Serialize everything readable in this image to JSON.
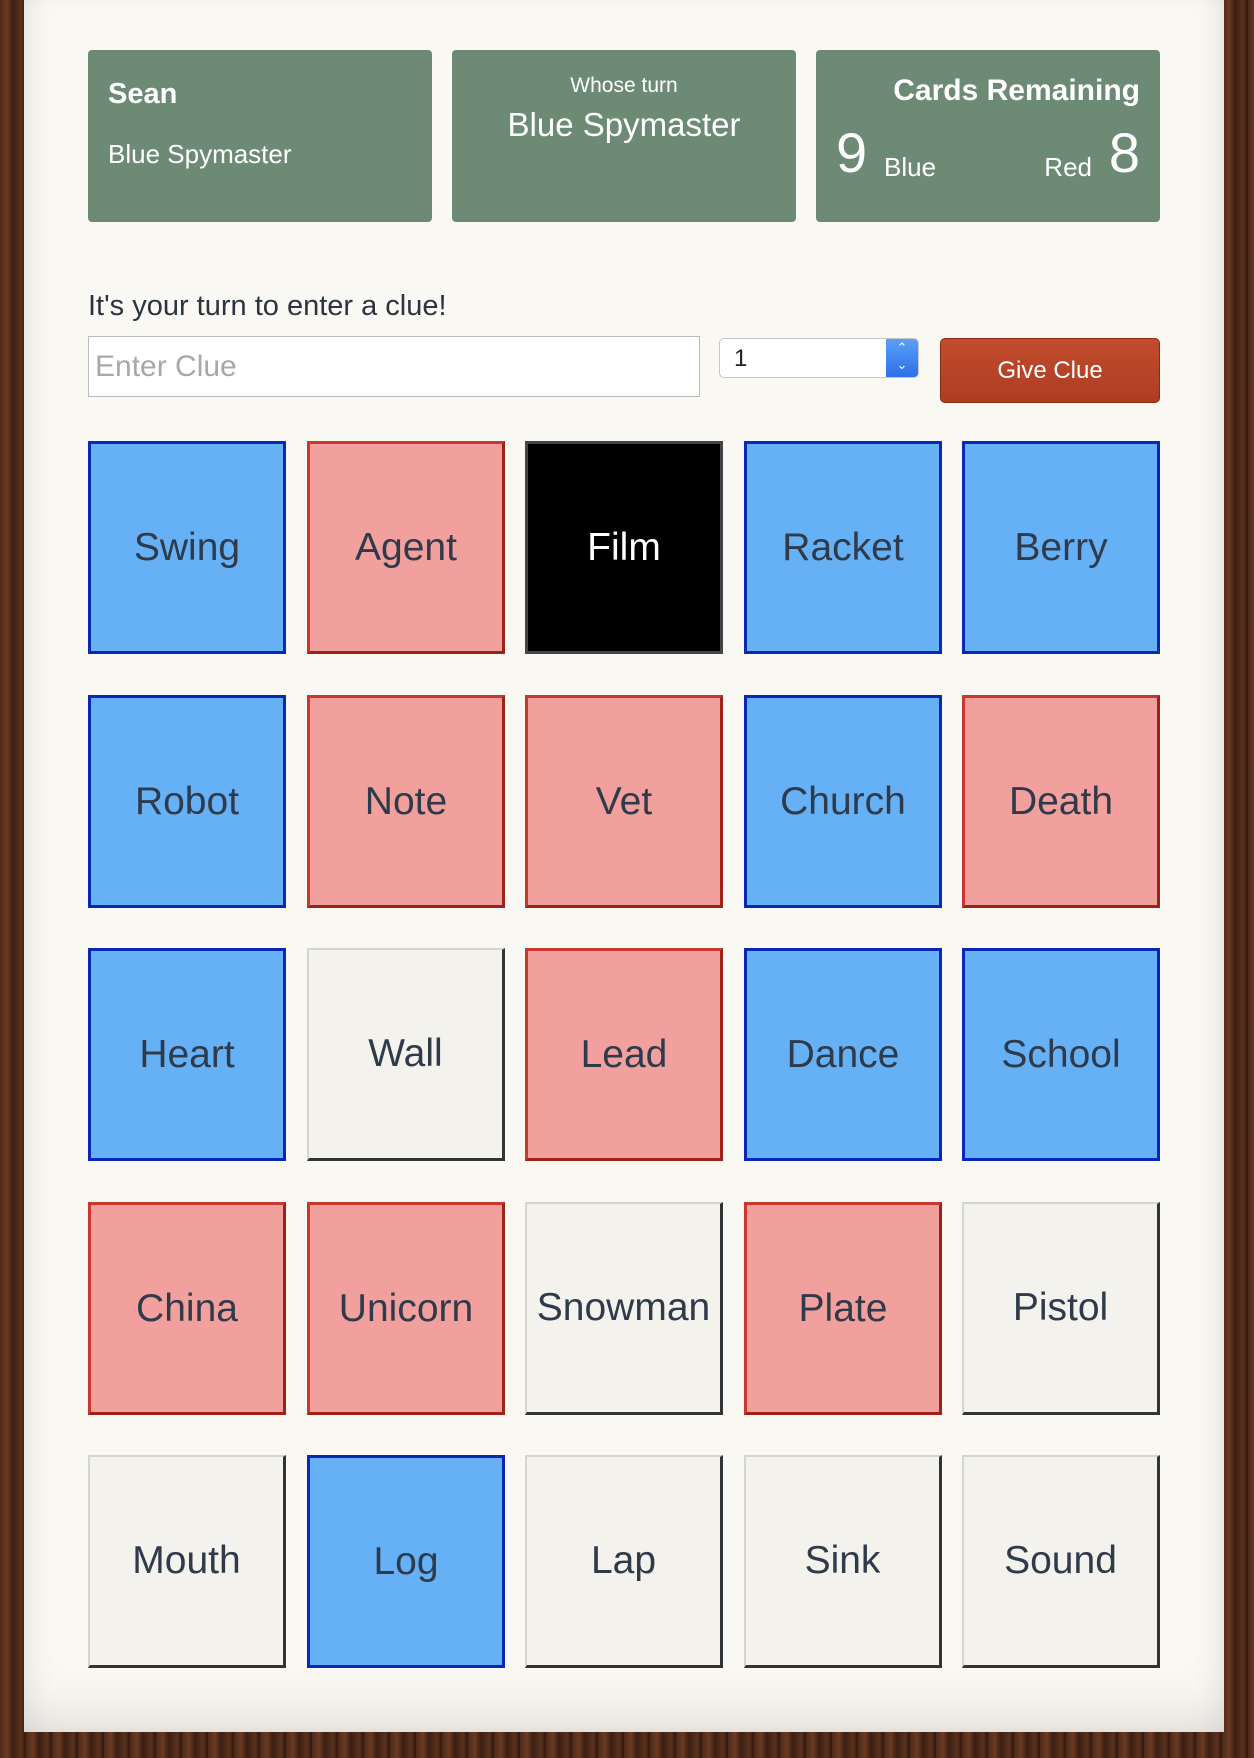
{
  "player": {
    "name": "Sean",
    "role": "Blue Spymaster"
  },
  "turn": {
    "label": "Whose turn",
    "value": "Blue Spymaster"
  },
  "cards_remaining": {
    "title": "Cards Remaining",
    "blue_count": "9",
    "blue_label": "Blue",
    "red_label": "Red",
    "red_count": "8"
  },
  "clue": {
    "prompt": "It's your turn to enter a clue!",
    "placeholder": "Enter Clue",
    "value": "",
    "count": "1",
    "button_label": "Give Clue"
  },
  "colors": {
    "blue": "#66b1f6",
    "red": "#f2a09d",
    "neutral": "#f3f2ec",
    "assassin": "#000000",
    "info_panel": "#6d8b74",
    "button": "#b8442a"
  },
  "board": [
    {
      "word": "Swing",
      "team": "blue"
    },
    {
      "word": "Agent",
      "team": "red"
    },
    {
      "word": "Film",
      "team": "black"
    },
    {
      "word": "Racket",
      "team": "blue"
    },
    {
      "word": "Berry",
      "team": "blue"
    },
    {
      "word": "Robot",
      "team": "blue"
    },
    {
      "word": "Note",
      "team": "red"
    },
    {
      "word": "Vet",
      "team": "red"
    },
    {
      "word": "Church",
      "team": "blue"
    },
    {
      "word": "Death",
      "team": "red"
    },
    {
      "word": "Heart",
      "team": "blue"
    },
    {
      "word": "Wall",
      "team": "neutral"
    },
    {
      "word": "Lead",
      "team": "red"
    },
    {
      "word": "Dance",
      "team": "blue"
    },
    {
      "word": "School",
      "team": "blue"
    },
    {
      "word": "China",
      "team": "red"
    },
    {
      "word": "Unicorn",
      "team": "red"
    },
    {
      "word": "Snowman",
      "team": "neutral"
    },
    {
      "word": "Plate",
      "team": "red"
    },
    {
      "word": "Pistol",
      "team": "neutral"
    },
    {
      "word": "Mouth",
      "team": "neutral"
    },
    {
      "word": "Log",
      "team": "blue"
    },
    {
      "word": "Lap",
      "team": "neutral"
    },
    {
      "word": "Sink",
      "team": "neutral"
    },
    {
      "word": "Sound",
      "team": "neutral"
    }
  ]
}
